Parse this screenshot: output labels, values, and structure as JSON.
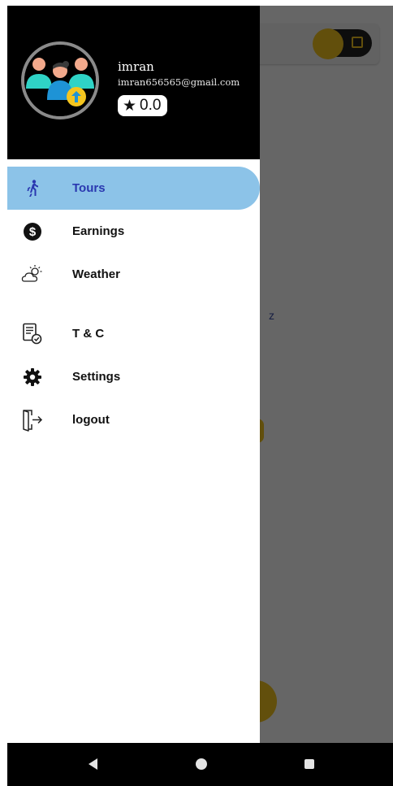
{
  "user": {
    "name": "imran",
    "email": "imran656565@gmail.com",
    "rating": "0.0",
    "rating_icon": "star-icon"
  },
  "menu": {
    "items": [
      {
        "label": "Tours",
        "icon": "walking-person-icon",
        "active": true
      },
      {
        "label": "Earnings",
        "icon": "dollar-coin-icon",
        "active": false
      },
      {
        "label": "Weather",
        "icon": "partly-cloudy-icon",
        "active": false
      },
      {
        "label": "T & C",
        "icon": "document-check-icon",
        "active": false
      },
      {
        "label": "Settings",
        "icon": "gear-icon",
        "active": false
      },
      {
        "label": "logout",
        "icon": "logout-icon",
        "active": false
      }
    ]
  },
  "background": {
    "floating_text": "z"
  },
  "colors": {
    "active_item_bg": "#8cc3e8",
    "active_item_text": "#2a38b0",
    "accent_yellow": "#f4c51f",
    "header_bg": "#000000"
  },
  "navbar": {
    "back_icon": "back-triangle-icon",
    "home_icon": "home-circle-icon",
    "recents_icon": "recents-square-icon"
  }
}
